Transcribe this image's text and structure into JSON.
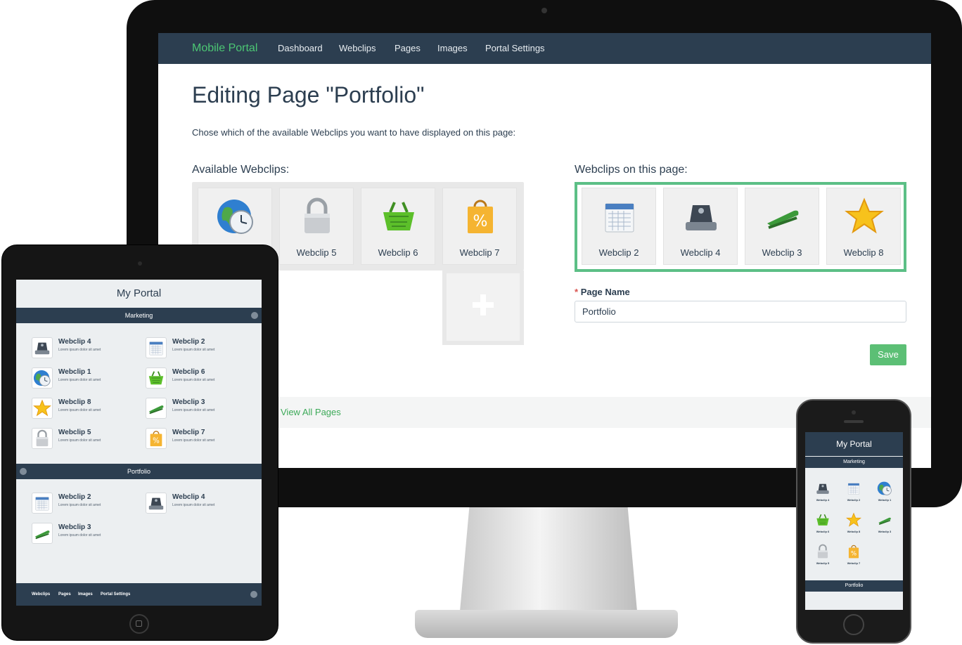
{
  "desktop": {
    "nav": {
      "brand": "Mobile Portal",
      "items": [
        "Dashboard",
        "Webclips",
        "Pages",
        "Images",
        "Portal Settings"
      ]
    },
    "title": "Editing Page \"Portfolio\"",
    "description": "Chose which of the available Webclips you want to have displayed on this page:",
    "available_heading": "Available Webclips:",
    "available": [
      {
        "label": "",
        "icon": "globe-clock-icon"
      },
      {
        "label": "Webclip 5",
        "icon": "padlock-icon"
      },
      {
        "label": "Webclip 6",
        "icon": "shopping-basket-icon"
      },
      {
        "label": "Webclip 7",
        "icon": "shopping-bag-icon"
      }
    ],
    "on_page_heading": "Webclips on this page:",
    "on_page": [
      {
        "label": "Webclip 2",
        "icon": "calendar-icon"
      },
      {
        "label": "Webclip 4",
        "icon": "hole-punch-icon"
      },
      {
        "label": "Webclip 3",
        "icon": "stapler-icon"
      },
      {
        "label": "Webclip 8",
        "icon": "star-icon"
      }
    ],
    "page_name_label": "Page Name",
    "page_name_required": "*",
    "page_name_value": "Portfolio",
    "save_label": "Save",
    "view_all_label": "View All Pages"
  },
  "tablet": {
    "title": "My Portal",
    "sections": [
      {
        "name": "Marketing",
        "items": [
          {
            "name": "Webclip 4",
            "desc": "Lorem ipsum dolor sit amet",
            "icon": "hole-punch-icon"
          },
          {
            "name": "Webclip 2",
            "desc": "Lorem ipsum dolor sit amet",
            "icon": "calendar-icon"
          },
          {
            "name": "Webclip 1",
            "desc": "Lorem ipsum dolor sit amet",
            "icon": "globe-clock-icon"
          },
          {
            "name": "Webclip 6",
            "desc": "Lorem ipsum dolor sit amet",
            "icon": "shopping-basket-icon"
          },
          {
            "name": "Webclip 8",
            "desc": "Lorem ipsum dolor sit amet",
            "icon": "star-icon"
          },
          {
            "name": "Webclip 3",
            "desc": "Lorem ipsum dolor sit amet",
            "icon": "stapler-icon"
          },
          {
            "name": "Webclip 5",
            "desc": "Lorem ipsum dolor sit amet",
            "icon": "padlock-icon"
          },
          {
            "name": "Webclip 7",
            "desc": "Lorem ipsum dolor sit amet",
            "icon": "shopping-bag-icon"
          }
        ]
      },
      {
        "name": "Portfolio",
        "items": [
          {
            "name": "Webclip 2",
            "desc": "Lorem ipsum dolor sit amet",
            "icon": "calendar-icon"
          },
          {
            "name": "Webclip 4",
            "desc": "Lorem ipsum dolor sit amet",
            "icon": "hole-punch-icon"
          },
          {
            "name": "Webclip 3",
            "desc": "Lorem ipsum dolor sit amet",
            "icon": "stapler-icon"
          }
        ]
      }
    ],
    "footer": [
      "Webclips",
      "Pages",
      "Images",
      "Portal Settings"
    ]
  },
  "phone": {
    "title": "My Portal",
    "sections": [
      {
        "name": "Marketing",
        "items": [
          {
            "name": "Webclip 4",
            "icon": "hole-punch-icon"
          },
          {
            "name": "Webclip 2",
            "icon": "calendar-icon"
          },
          {
            "name": "Webclip 1",
            "icon": "globe-clock-icon"
          },
          {
            "name": "Webclip 6",
            "icon": "shopping-basket-icon"
          },
          {
            "name": "Webclip 8",
            "icon": "star-icon"
          },
          {
            "name": "Webclip 3",
            "icon": "stapler-icon"
          },
          {
            "name": "Webclip 5",
            "icon": "padlock-icon"
          },
          {
            "name": "Webclip 7",
            "icon": "shopping-bag-icon"
          }
        ]
      },
      {
        "name": "Portfolio",
        "items": []
      }
    ]
  },
  "colors": {
    "navbar": "#2c3e50",
    "brand": "#4cc774",
    "accent_green": "#5cbf75",
    "drop_zone_border": "#5cbf86",
    "text": "#2c3e50"
  }
}
